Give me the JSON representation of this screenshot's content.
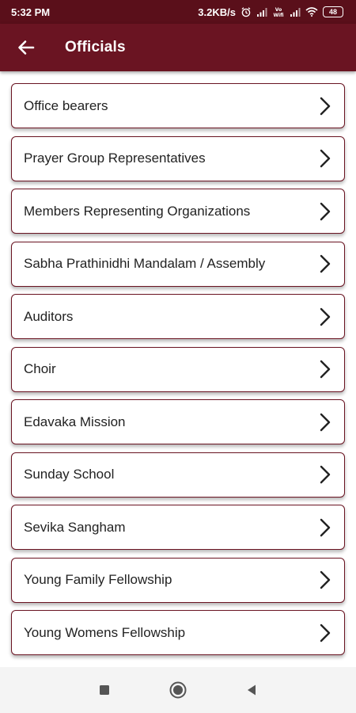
{
  "status_bar": {
    "time": "5:32 PM",
    "network_speed": "3.2KB/s",
    "volte_label": "Vo Wifi",
    "battery": "48",
    "icons": [
      "alarm-icon",
      "signal-icon",
      "volte-wifi-icon",
      "signal-icon",
      "wifi-icon",
      "battery-icon"
    ]
  },
  "app_bar": {
    "title": "Officials",
    "back_icon": "arrow-left-icon"
  },
  "list": {
    "items": [
      {
        "label": "Office bearers"
      },
      {
        "label": "Prayer Group Representatives"
      },
      {
        "label": "Members Representing Organizations"
      },
      {
        "label": "Sabha Prathinidhi Mandalam / Assembly"
      },
      {
        "label": "Auditors"
      },
      {
        "label": "Choir"
      },
      {
        "label": "Edavaka Mission"
      },
      {
        "label": "Sunday School"
      },
      {
        "label": "Sevika Sangham"
      },
      {
        "label": "Young Family Fellowship"
      },
      {
        "label": "Young Womens Fellowship"
      }
    ],
    "chevron_icon": "chevron-right-icon"
  },
  "nav_bar": {
    "icons": [
      "recents-square-icon",
      "home-circle-icon",
      "back-triangle-icon"
    ]
  },
  "colors": {
    "status_bar": "#5a0f1a",
    "app_bar": "#6a1422",
    "item_border": "#6a1422",
    "text": "#222222"
  }
}
